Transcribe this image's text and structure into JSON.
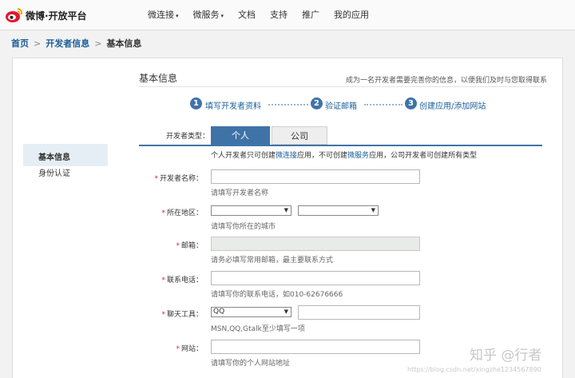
{
  "header": {
    "logo_text": "微博·开放平台",
    "nav": [
      {
        "label": "微连接",
        "has_dropdown": true
      },
      {
        "label": "微服务",
        "has_dropdown": true
      },
      {
        "label": "文档",
        "has_dropdown": false
      },
      {
        "label": "支持",
        "has_dropdown": false
      },
      {
        "label": "推广",
        "has_dropdown": false
      },
      {
        "label": "我的应用",
        "has_dropdown": false
      }
    ],
    "caret": "▾"
  },
  "breadcrumb": {
    "home": "首页",
    "developer": "开发者信息",
    "current": "基本信息",
    "sep": ">"
  },
  "sidebar": {
    "items": [
      {
        "label": "基本信息",
        "active": true
      },
      {
        "label": "身份认证",
        "active": false
      }
    ]
  },
  "section": {
    "title": "基本信息",
    "hint": "成为一名开发者需要完善你的信息，以便我们及时与您取得联系"
  },
  "steps": [
    {
      "num": "1",
      "label": "填写开发者资料"
    },
    {
      "num": "2",
      "label": "验证邮箱"
    },
    {
      "num": "3",
      "label": "创建应用/添加网站"
    }
  ],
  "developer_type": {
    "label": "开发者类型：",
    "tabs": [
      {
        "label": "个人",
        "active": true
      },
      {
        "label": "公司",
        "active": false
      }
    ],
    "note_1": "个人开发者只可创建",
    "note_link_1": "微连接",
    "note_2": "应用，不可创建",
    "note_link_2": "微服务",
    "note_3": "应用，公司开发者可创建所有类型"
  },
  "form": {
    "name": {
      "label": "开发者名称：",
      "required": true,
      "value": "",
      "help": "请填写开发者名称"
    },
    "region": {
      "label": "所在地区：",
      "required": true,
      "province": "",
      "city": "",
      "help": "请填写你所在的城市"
    },
    "email": {
      "label": "邮箱：",
      "required": true,
      "value": "",
      "help": "请务必填写常用邮箱，最主要联系方式"
    },
    "phone": {
      "label": "联系电话：",
      "required": true,
      "value": "",
      "help": "请填写你的联系电话，如010-62676666"
    },
    "im": {
      "label": "聊天工具：",
      "required": true,
      "selected": "QQ",
      "value": "",
      "help": "MSN,QQ,Gtalk至少填写一项"
    },
    "website": {
      "label": "网站：",
      "required": true,
      "value": "",
      "help": "请填写你的个人网站地址"
    }
  },
  "watermark": {
    "main": "知乎 @行者",
    "url": "https://blog.csdn.net/xingzhe1234567890"
  },
  "colors": {
    "accent": "#3f73a8",
    "link": "#1a5e9a",
    "required": "#dd2222"
  },
  "icons": {
    "logo": "weibo-eye-logo",
    "dropdown": "chevron-down-icon"
  }
}
